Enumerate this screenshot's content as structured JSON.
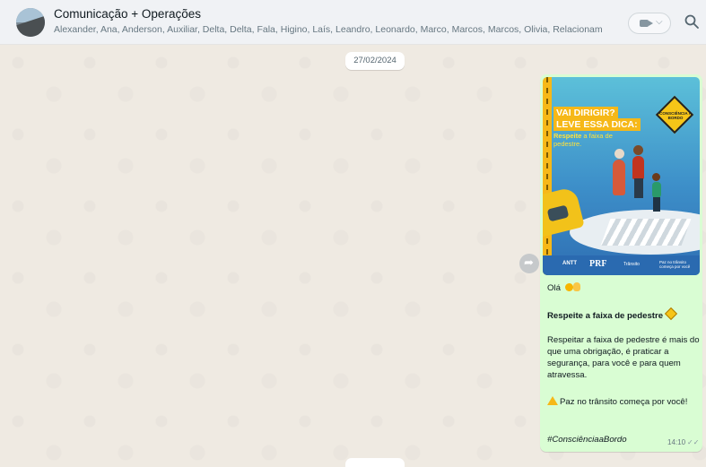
{
  "header": {
    "title": "Comunicação + Operações",
    "members": "Alexander, Ana, Anderson, Auxiliar, Delta, Delta, Fala, Higino, Laís, Leandro, Leonardo, Marco, Marcos, Marcos, Olivia, Relacionamento, Rinaldo, ...",
    "video_icon": "video-camera-icon",
    "search_icon": "search-icon"
  },
  "chat": {
    "date": "27/02/2024",
    "message": {
      "poster": {
        "headline1": "VAI DIRIGIR?",
        "headline2": "LEVE ESSA DICA:",
        "sub_bold": "Respeite",
        "sub_rest": "a faixa de pedestre.",
        "badge": "CONSCIÊNCIA A BORDO",
        "logo_antt": "ANTT",
        "logo_prf": "PRF",
        "logo_transito": "Trânsito",
        "tagline": "Paz no trânsito começa por você"
      },
      "greeting": "Olá",
      "heading": "Respeite a faixa de pedestre",
      "body": "Respeitar a faixa de pedestre é mais do que uma obrigação, é praticar a segurança, para você e para quem atravessa.",
      "warning": "Paz no trânsito começa por você!",
      "hashtag": "#ConsciênciaaBordo",
      "time": "14:10"
    }
  },
  "colors": {
    "header_bg": "#f0f2f5",
    "chat_bg": "#efeae2",
    "outgoing_bubble": "#d9fdd3",
    "meta_text": "#667781"
  }
}
